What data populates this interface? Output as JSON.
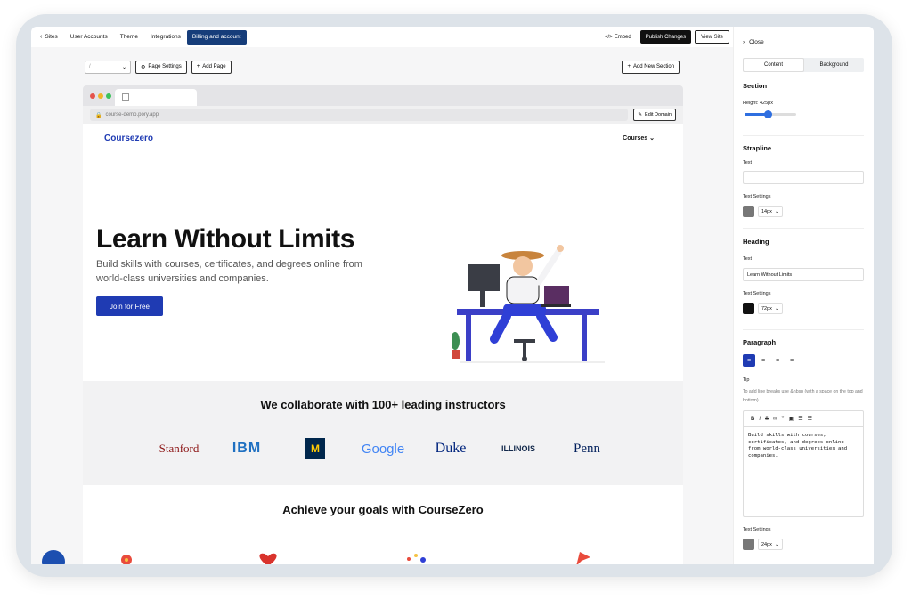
{
  "topbar": {
    "back_label": "Sites",
    "nav": [
      "User Accounts",
      "Theme",
      "Integrations"
    ],
    "active_nav": "Billing and account",
    "embed_label": "Embed",
    "publish_label": "Publish Changes",
    "view_site_label": "View Site"
  },
  "toolbar": {
    "page_select_value": "/",
    "page_settings_label": "Page Settings",
    "add_page_label": "Add Page",
    "add_section_label": "Add New Section"
  },
  "browser": {
    "url": "course-demo.pory.app",
    "edit_domain_label": "Edit Domain"
  },
  "site": {
    "logo": "Coursezero",
    "nav_courses": "Courses",
    "hero_heading": "Learn Without Limits",
    "hero_paragraph": "Build skills with courses, certificates, and degrees online from world-class universities and companies.",
    "cta_label": "Join for Free",
    "partners_heading": "We collaborate with 100+ leading instructors",
    "partner_logos": [
      "Stanford",
      "IBM",
      "M",
      "Google",
      "Duke",
      "ILLINOIS",
      "Penn"
    ],
    "goals_heading": "Achieve your goals with CourseZero"
  },
  "panel": {
    "close_label": "Close",
    "tabs": [
      "Content",
      "Background"
    ],
    "section_title": "Section",
    "height_label": "Height: 425px",
    "height_value": 0.45,
    "strapline_title": "Strapline",
    "strapline_text_label": "Text",
    "strapline_text_value": "",
    "strapline_settings_label": "Text Settings",
    "strapline_size": "14px",
    "heading_title": "Heading",
    "heading_text_label": "Text",
    "heading_text_value": "Learn Without Limits",
    "heading_settings_label": "Text Settings",
    "heading_size": "72px",
    "paragraph_title": "Paragraph",
    "tip_label": "Tip",
    "tip_text": "To add line breaks use &nbsp (with a space on the top and bottom)",
    "paragraph_body": "Build skills with courses, certificates, and degrees online from world-class universities and companies.",
    "paragraph_settings_label": "Text Settings",
    "paragraph_size": "24px"
  },
  "colors": {
    "accent": "#1f3bb3",
    "active_nav_bg": "#163d7a",
    "dark": "#111111"
  }
}
